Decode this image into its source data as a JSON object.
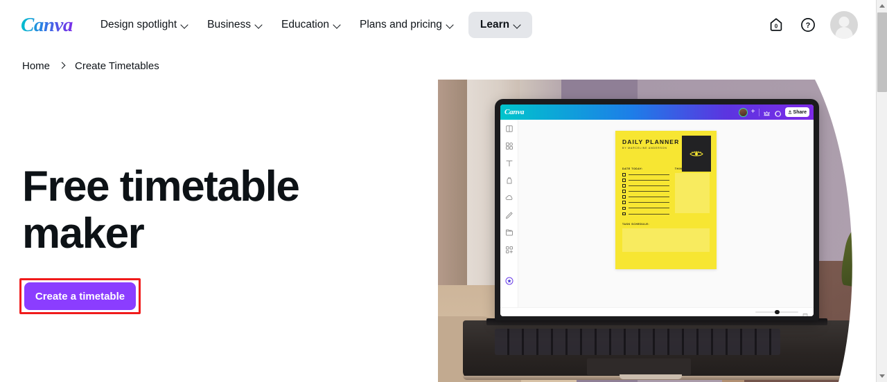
{
  "navbar": {
    "brand": "Canva",
    "items": [
      {
        "label": "Design spotlight",
        "has_caret": true
      },
      {
        "label": "Business",
        "has_caret": true
      },
      {
        "label": "Education",
        "has_caret": true
      },
      {
        "label": "Plans and pricing",
        "has_caret": true
      },
      {
        "label": "Learn",
        "has_caret": true,
        "style": "pill"
      }
    ],
    "right": {
      "home_icon": "home-icon",
      "home_badge": "0",
      "help_icon": "help-question-icon",
      "avatar": "user-avatar"
    }
  },
  "breadcrumb": {
    "home": "Home",
    "separator": "chevron-right-icon",
    "current": "Create Timetables"
  },
  "hero": {
    "title_line1": "Free timetable",
    "title_line2": "maker",
    "cta_label": "Create a timetable",
    "cta_color": "#8b3dff",
    "highlight_color": "#f01b1b"
  },
  "editor_preview": {
    "logo": "Canva",
    "share_label": "Share",
    "plus_label": "+",
    "rail_icons": [
      "design-icon",
      "elements-icon",
      "text-icon",
      "brand-icon",
      "uploads-icon",
      "draw-icon",
      "projects-icon",
      "apps-icon",
      "magic-icon"
    ],
    "top_icons": [
      "crown-icon",
      "comment-icon",
      "upload-share-icon"
    ],
    "zoom_percent": 45,
    "page_icon": "pages-icon",
    "planner": {
      "title": "DAILY PLANNER",
      "byline": "BY MARCELINE ANDERSON",
      "label_date": "DATE TODAY:",
      "label_todo": "THINGS TO DO:",
      "label_schedule": "TASK SCHEDULE:",
      "checkbox_rows": 8,
      "bg_color": "#f7e632",
      "badge_color": "#222224"
    }
  },
  "scrollbar": {
    "up_arrow": "scroll-up-arrow",
    "down_arrow": "scroll-down-arrow",
    "thumb": "scroll-thumb"
  }
}
